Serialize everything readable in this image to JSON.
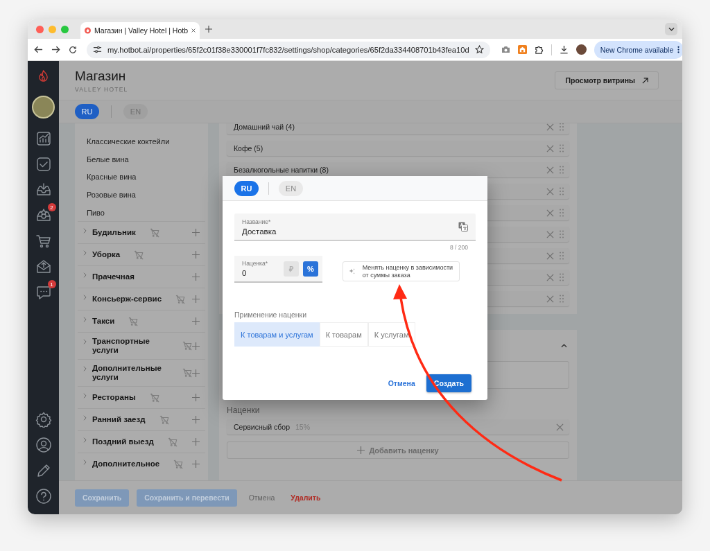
{
  "browser": {
    "tab_title": "Магазин | Valley Hotel | Hotb",
    "url": "my.hotbot.ai/properties/65f2c01f38e330001f7fc832/settings/shop/categories/65f2da334408701b43fea10d",
    "update_button": "New Chrome available"
  },
  "rail": {
    "items": [
      {
        "kind": "chart"
      },
      {
        "kind": "check"
      },
      {
        "kind": "inbox"
      },
      {
        "kind": "inbox-star",
        "badge": "2"
      },
      {
        "kind": "cart"
      },
      {
        "kind": "mail"
      },
      {
        "kind": "chat",
        "badge": "1"
      }
    ],
    "bottom": [
      {
        "kind": "gear"
      },
      {
        "kind": "user"
      },
      {
        "kind": "pencil"
      },
      {
        "kind": "help"
      }
    ]
  },
  "page": {
    "title": "Магазин",
    "subtitle": "VALLEY HOTEL",
    "storefront_button": "Просмотр витрины"
  },
  "languages": [
    {
      "label": "RU",
      "selected": true
    },
    {
      "label": "EN",
      "selected": false
    }
  ],
  "category_tree": {
    "subitems": [
      "Классические коктейли",
      "Белые вина",
      "Красные вина",
      "Розовые вина",
      "Пиво"
    ],
    "groups": [
      {
        "label": "Будильник",
        "shop_disabled": true
      },
      {
        "label": "Уборка",
        "shop_disabled": true
      },
      {
        "label": "Прачечная",
        "shop_disabled": false
      },
      {
        "label": "Консьерж-сервис",
        "shop_disabled": true
      },
      {
        "label": "Такси",
        "shop_disabled": true
      },
      {
        "label": "Транспортные услуги",
        "shop_disabled": true
      },
      {
        "label": "Дополнительные услуги",
        "shop_disabled": true
      },
      {
        "label": "Рестораны",
        "shop_disabled": true
      },
      {
        "label": "Ранний заезд",
        "shop_disabled": true
      },
      {
        "label": "Поздний выезд",
        "shop_disabled": true
      },
      {
        "label": "Дополнительное",
        "shop_disabled": true
      }
    ]
  },
  "category_list": [
    {
      "kind": "labeled",
      "label": "Домашний чай (4)"
    },
    {
      "kind": "labeled",
      "label": "Кофе (5)"
    },
    {
      "kind": "labeled",
      "label": "Безалкогольные напитки (8)"
    },
    {
      "kind": "covered"
    },
    {
      "kind": "covered"
    },
    {
      "kind": "covered"
    },
    {
      "kind": "covered"
    },
    {
      "kind": "covered"
    },
    {
      "kind": "covered"
    }
  ],
  "markups_section": {
    "title": "Наценки",
    "items": [
      {
        "name": "Сервисный сбор",
        "value": "15%"
      }
    ],
    "add_button": "Добавить наценку"
  },
  "footer": {
    "buttons": [
      {
        "label": "Сохранить",
        "kind": "primary"
      },
      {
        "label": "Сохранить и перевести",
        "kind": "primary"
      },
      {
        "label": "Отмена",
        "kind": "text"
      },
      {
        "label": "Удалить",
        "kind": "danger"
      }
    ]
  },
  "modal": {
    "languages": [
      {
        "label": "RU",
        "selected": true
      },
      {
        "label": "EN",
        "selected": false
      }
    ],
    "name_field": {
      "label": "Название*",
      "value": "Доставка",
      "counter": "8 / 200"
    },
    "markup_field": {
      "label": "Наценка*",
      "value": "0",
      "units": [
        {
          "label": "₽",
          "selected": false
        },
        {
          "label": "%",
          "selected": true
        }
      ]
    },
    "dynamic_markup_button": "Менять наценку в зависимости от суммы заказа",
    "apply_label": "Применение наценки",
    "apply_options": [
      {
        "label": "К товарам и услугам",
        "selected": true
      },
      {
        "label": "К товарам",
        "selected": false
      },
      {
        "label": "К услугам",
        "selected": false
      }
    ],
    "cancel_button": "Отмена",
    "submit_button": "Создать"
  }
}
